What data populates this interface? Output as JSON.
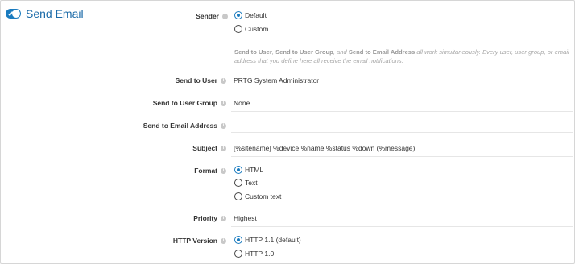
{
  "section": {
    "title": "Send Email",
    "enabled": true
  },
  "sender": {
    "label": "Sender",
    "options": [
      "Default",
      "Custom"
    ],
    "selected": "Default"
  },
  "note": {
    "part1": "Send to User",
    "sep1": ", ",
    "part2": "Send to User Group",
    "sep2": ", and ",
    "part3": "Send to Email Address",
    "rest": " all work simultaneously. Every user, user group, or email address that you define here all receive the email notifications."
  },
  "send_to_user": {
    "label": "Send to User",
    "value": "PRTG System Administrator"
  },
  "send_to_user_group": {
    "label": "Send to User Group",
    "value": "None"
  },
  "send_to_email": {
    "label": "Send to Email Address",
    "value": ""
  },
  "subject": {
    "label": "Subject",
    "value": "[%sitename] %device %name %status %down (%message)"
  },
  "format": {
    "label": "Format",
    "options": [
      "HTML",
      "Text",
      "Custom text"
    ],
    "selected": "HTML"
  },
  "priority": {
    "label": "Priority",
    "value": "Highest"
  },
  "http_version": {
    "label": "HTTP Version",
    "options": [
      "HTTP 1.1 (default)",
      "HTTP 1.0"
    ],
    "selected": "HTTP 1.1 (default)"
  },
  "help_glyph": "i",
  "colors": {
    "accent": "#1a7bbf",
    "title": "#1a6aa8",
    "note": "#a6a6a6"
  }
}
